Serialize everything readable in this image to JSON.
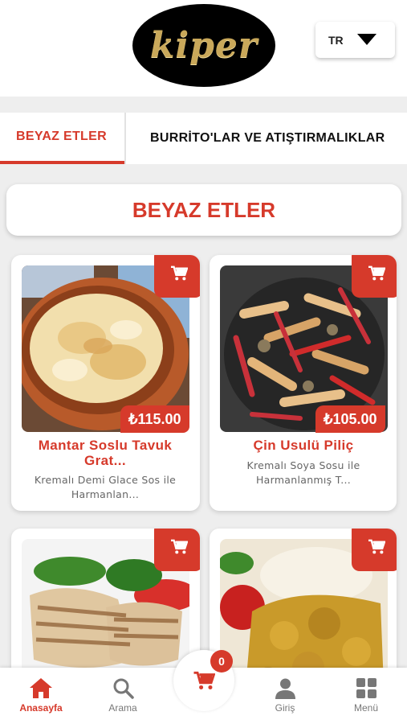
{
  "brand": {
    "logo_text": "kiper"
  },
  "language": {
    "current": "TR"
  },
  "tabs": [
    {
      "label": "BEYAZ ETLER",
      "active": true
    },
    {
      "label": "BURRİTO'LAR VE ATIŞTIRMALIKLAR",
      "active": false
    }
  ],
  "section": {
    "title": "BEYAZ ETLER"
  },
  "products": [
    {
      "name": "Mantar Soslu Tavuk Grat...",
      "price": "₺115.00",
      "description": "Kremalı Demi Glace Sos ile Harmanlan..."
    },
    {
      "name": "Çin Usulü Piliç",
      "price": "₺105.00",
      "description": "Kremalı Soya Sosu ile Harmanlanmış T..."
    },
    {
      "name": "",
      "price": "",
      "description": ""
    },
    {
      "name": "",
      "price": "",
      "description": ""
    }
  ],
  "cart": {
    "count": "0"
  },
  "bottom_nav": [
    {
      "label": "Anasayfa",
      "icon": "home-icon",
      "active": true
    },
    {
      "label": "Arama",
      "icon": "search-icon",
      "active": false
    },
    {
      "label": "Giriş",
      "icon": "user-icon",
      "active": false
    },
    {
      "label": "Menü",
      "icon": "grid-icon",
      "active": false
    }
  ],
  "colors": {
    "accent": "#d63a2b",
    "background": "#eeeeee",
    "logo_gold": "#c9a85a"
  }
}
